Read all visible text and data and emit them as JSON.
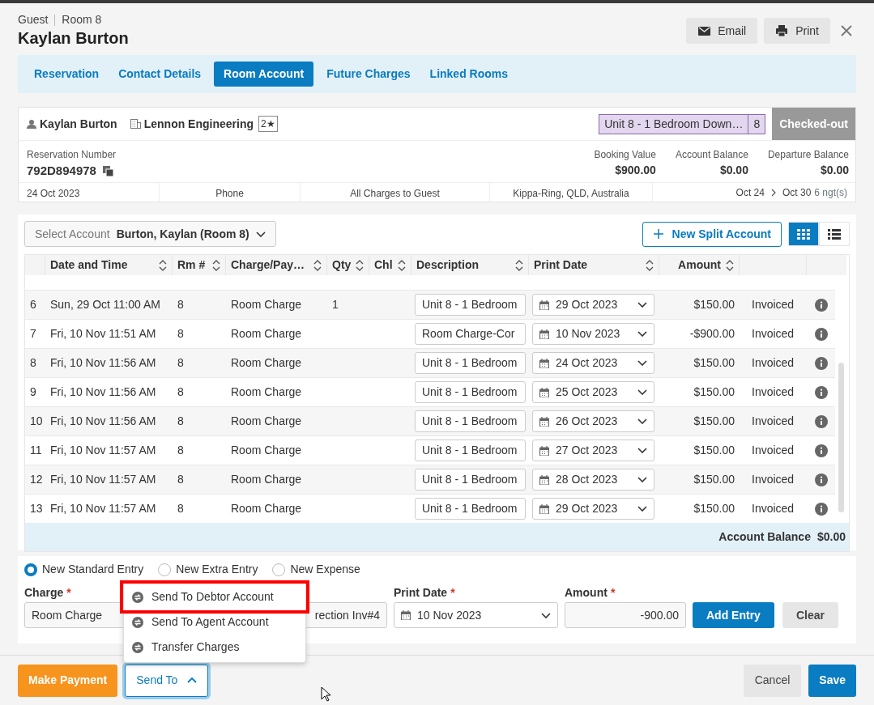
{
  "header": {
    "crumbs": [
      "Guest",
      "Room 8"
    ],
    "title": "Kaylan Burton",
    "actions": [
      {
        "label": "Email",
        "kind": "email"
      },
      {
        "label": "Print",
        "kind": "print"
      }
    ]
  },
  "tabs": [
    {
      "label": "Reservation",
      "selected": false
    },
    {
      "label": "Contact Details",
      "selected": false
    },
    {
      "label": "Room Account",
      "selected": true
    },
    {
      "label": "Future Charges",
      "selected": false
    },
    {
      "label": "Linked Rooms",
      "selected": false
    }
  ],
  "summary": {
    "guest": "Kaylan Burton",
    "company": "Lennon Engineering",
    "guest_count": "2★",
    "room": "Unit 8 - 1 Bedroom Down…",
    "room_number": "8",
    "status": "Checked-out",
    "reservation_label": "Reservation Number",
    "reservation_number": "792D894978",
    "stats": [
      {
        "label": "Booking Value",
        "value": "$900.00"
      },
      {
        "label": "Account Balance",
        "value": "$0.00"
      },
      {
        "label": "Departure Balance",
        "value": "$0.00"
      }
    ],
    "details": [
      "24 Oct 2023",
      "Phone",
      "All Charges to Guest",
      "Kippa-Ring, QLD, Australia"
    ],
    "arrival": "Oct 24",
    "departure": "Oct 30",
    "nights": "6 ngt(s)"
  },
  "account": {
    "select_label": "Select Account",
    "select_value": "Burton, Kaylan (Room 8)",
    "new_split": "New Split Account",
    "views": [
      {
        "kind": "grid",
        "selected": true
      },
      {
        "kind": "list",
        "selected": false
      }
    ]
  },
  "table": {
    "columns": [
      "Date and Time",
      "Rm #",
      "Charge/Pay…",
      "Qty",
      "Chl",
      "Description",
      "Print Date",
      "Amount"
    ],
    "rows": [
      {
        "num": "6",
        "datetime": "Sun, 29 Oct 11:00 AM",
        "room": "8",
        "charge": "Room Charge",
        "qty": "1",
        "description": "Unit 8 - 1 Bedroom",
        "print_date": "29 Oct 2023",
        "amount": "$150.00",
        "status": "Invoiced"
      },
      {
        "num": "7",
        "datetime": "Fri, 10 Nov 11:51 AM",
        "room": "8",
        "charge": "Room Charge",
        "description": "Room Charge-Cor",
        "print_date": "10 Nov 2023",
        "amount": "-$900.00",
        "status": "Invoiced"
      },
      {
        "num": "8",
        "datetime": "Fri, 10 Nov 11:56 AM",
        "room": "8",
        "charge": "Room Charge",
        "description": "Unit 8 - 1 Bedroom",
        "print_date": "24 Oct 2023",
        "amount": "$150.00",
        "status": "Invoiced"
      },
      {
        "num": "9",
        "datetime": "Fri, 10 Nov 11:56 AM",
        "room": "8",
        "charge": "Room Charge",
        "description": "Unit 8 - 1 Bedroom",
        "print_date": "25 Oct 2023",
        "amount": "$150.00",
        "status": "Invoiced"
      },
      {
        "num": "10",
        "datetime": "Fri, 10 Nov 11:56 AM",
        "room": "8",
        "charge": "Room Charge",
        "description": "Unit 8 - 1 Bedroom",
        "print_date": "26 Oct 2023",
        "amount": "$150.00",
        "status": "Invoiced"
      },
      {
        "num": "11",
        "datetime": "Fri, 10 Nov 11:57 AM",
        "room": "8",
        "charge": "Room Charge",
        "description": "Unit 8 - 1 Bedroom",
        "print_date": "27 Oct 2023",
        "amount": "$150.00",
        "status": "Invoiced"
      },
      {
        "num": "12",
        "datetime": "Fri, 10 Nov 11:57 AM",
        "room": "8",
        "charge": "Room Charge",
        "description": "Unit 8 - 1 Bedroom",
        "print_date": "28 Oct 2023",
        "amount": "$150.00",
        "status": "Invoiced"
      },
      {
        "num": "13",
        "datetime": "Fri, 10 Nov 11:57 AM",
        "room": "8",
        "charge": "Room Charge",
        "description": "Unit 8 - 1 Bedroom",
        "print_date": "29 Oct 2023",
        "amount": "$150.00",
        "status": "Invoiced"
      }
    ],
    "footer_label": "Account Balance",
    "footer_value": "$0.00"
  },
  "entry": {
    "types": [
      {
        "label": "New Standard Entry",
        "selected": true
      },
      {
        "label": "New Extra Entry",
        "selected": false
      },
      {
        "label": "New Expense",
        "selected": false
      }
    ],
    "charge_label": "Charge",
    "required_mark": "*",
    "charge_value": "Room Charge",
    "description_value": "rection Inv#4",
    "print_date_label": "Print Date",
    "print_date_value": "10 Nov 2023",
    "amount_label": "Amount",
    "amount_value": "-900.00",
    "buttons": [
      {
        "label": "Add Entry",
        "kind": "primary"
      },
      {
        "label": "Clear",
        "kind": "secondary"
      }
    ]
  },
  "send_menu": {
    "items": [
      {
        "label": "Send To Debtor Account",
        "highlighted": true
      },
      {
        "label": "Send To Agent Account",
        "highlighted": false
      },
      {
        "label": "Transfer Charges",
        "highlighted": false
      }
    ]
  },
  "footer": {
    "make_payment": "Make Payment",
    "send_to": "Send To",
    "send_open": true,
    "cancel": "Cancel",
    "save": "Save"
  }
}
